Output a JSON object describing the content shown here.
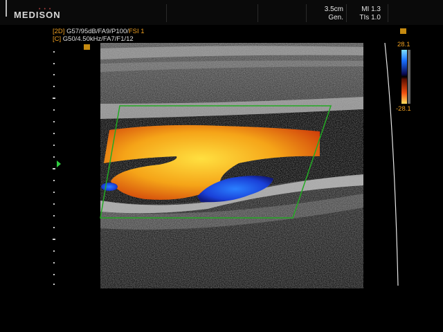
{
  "header": {
    "brand": "MEDISON",
    "brand_dots": "•••",
    "depth": "3.5cm",
    "preset": "Gen.",
    "mi": "MI 1.3",
    "tis": "TIs 1.0"
  },
  "params": {
    "mode2d": "[2D]",
    "line2d": "G57/95dB/FA9/P100/",
    "fsi": "FSI 1",
    "modeC": "[C]",
    "lineC": "G50/4.50kHz/FA7/F1/12"
  },
  "color_scale": {
    "max": "28.1",
    "min": "-28.1"
  },
  "colors": {
    "forward_flow": "#f0a020",
    "reverse_flow": "#1a40e0",
    "roi_box": "#22aa22",
    "focus_marker": "#2ecc40"
  }
}
